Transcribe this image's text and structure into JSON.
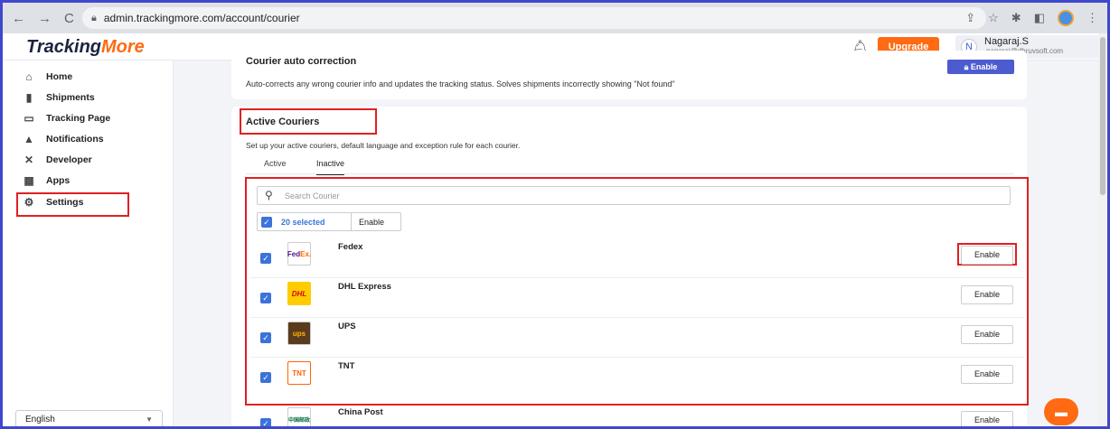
{
  "browser": {
    "url": "admin.trackingmore.com/account/courier"
  },
  "header": {
    "logo_main": "Tracking",
    "logo_accent": "More",
    "upgrade_label": "Upgrade",
    "user_initial": "N",
    "user_name": "Nagaraj.S",
    "user_email": "nagaraj@dhruvsoft.com"
  },
  "sidebar": {
    "items": [
      {
        "label": "Home",
        "icon": "home-icon"
      },
      {
        "label": "Shipments",
        "icon": "truck-icon"
      },
      {
        "label": "Tracking Page",
        "icon": "monitor-icon"
      },
      {
        "label": "Notifications",
        "icon": "bell-icon"
      },
      {
        "label": "Developer",
        "icon": "tools-icon"
      },
      {
        "label": "Apps",
        "icon": "apps-icon"
      },
      {
        "label": "Settings",
        "icon": "gear-icon"
      }
    ],
    "language": "English"
  },
  "auto_correction": {
    "title": "Courier auto correction",
    "description": "Auto-corrects any wrong courier info and updates the tracking status. Solves shipments incorrectly showing \"Not found\"",
    "enable_label": "Enable"
  },
  "active_couriers": {
    "title": "Active Couriers",
    "description": "Set up your active couriers, default language and exception rule for each courier.",
    "tabs": [
      "Active",
      "Inactive"
    ],
    "active_tab": "Inactive",
    "search_placeholder": "Search Courier",
    "selected_label": "20 selected",
    "bulk_enable_label": "Enable",
    "couriers": [
      {
        "name": "Fedex",
        "enable_label": "Enable",
        "logo_text": "FedEx."
      },
      {
        "name": "DHL Express",
        "enable_label": "Enable",
        "logo_text": "DHL"
      },
      {
        "name": "UPS",
        "enable_label": "Enable",
        "logo_text": "ups"
      },
      {
        "name": "TNT",
        "enable_label": "Enable",
        "logo_text": "TNT"
      },
      {
        "name": "China Post",
        "enable_label": "Enable",
        "logo_text": "中国邮政"
      }
    ]
  },
  "colors": {
    "accent_orange": "#ff6a13",
    "primary_blue": "#4c5bcd",
    "highlight_red": "#e02020"
  }
}
